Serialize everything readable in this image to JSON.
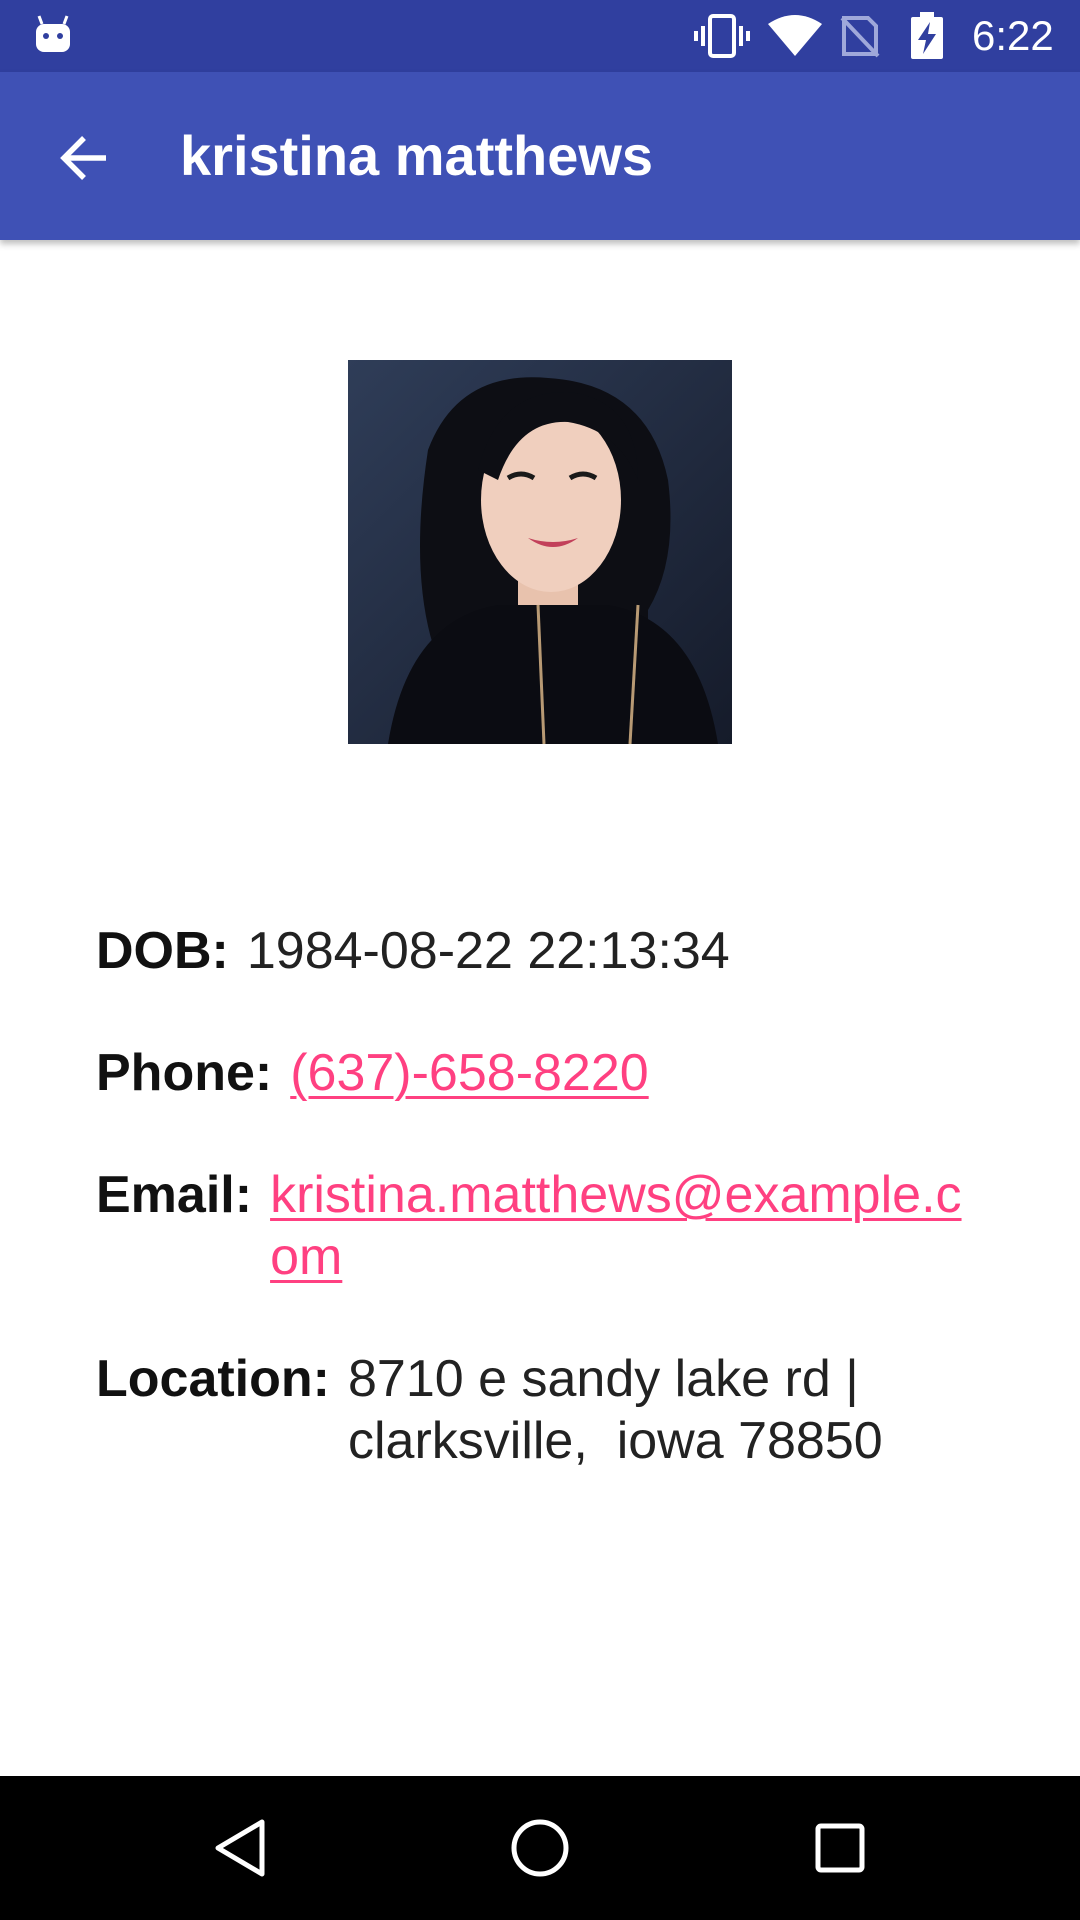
{
  "status_bar": {
    "time": "6:22",
    "icons": [
      "android-notification-icon",
      "vibrate-icon",
      "wifi-icon",
      "no-sim-signal-icon",
      "battery-charging-icon"
    ]
  },
  "app_bar": {
    "title": "kristina matthews",
    "back_icon": "arrow-back-icon"
  },
  "profile": {
    "photo": "profile-photo",
    "dob_label": "DOB:",
    "dob_value": "1984-08-22 22:13:34",
    "phone_label": "Phone:",
    "phone_value": "(637)-658-8220",
    "email_label": "Email:",
    "email_value": "kristina.matthews@example.com",
    "location_label": "Location:",
    "location_value": "8710 e sandy lake rd | clarksville,  iowa 78850"
  },
  "colors": {
    "status_bar": "#303F9F",
    "app_bar": "#3F51B5",
    "link": "#FF4081"
  },
  "nav_bar": {
    "icons": [
      "back-triangle-icon",
      "home-circle-icon",
      "recents-square-icon"
    ]
  }
}
